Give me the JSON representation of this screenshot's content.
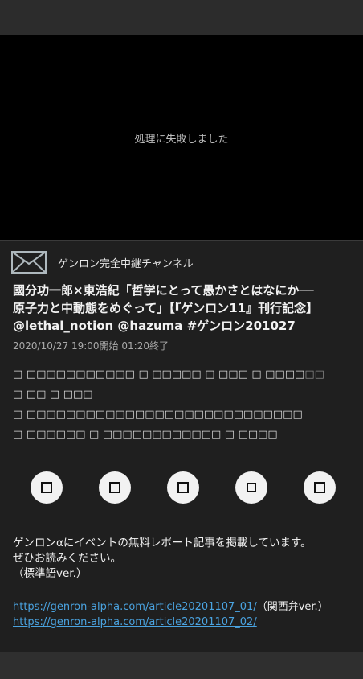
{
  "player": {
    "error_message": "処理に失敗しました"
  },
  "channel": {
    "name": "ゲンロン完全中継チャンネル",
    "icon": "mail-envelope-icon"
  },
  "program": {
    "title_lines": [
      "國分功一郎×東浩紀「哲学にとって愚かさとはなにか──",
      "原子力と中動態をめぐって」【『ゲンロン11』刊行記念】",
      "@lethal_notion @hazuma #ゲンロン201027"
    ],
    "time": "2020/10/27 19:00開始 01:20終了"
  },
  "tags": {
    "line1": "□ □□□□□□□□□□□ □ □□□□□ □ □□□ □ □□□□",
    "line1_fade": "□□",
    "line2": "□ □□ □ □□□",
    "line3": "□ □□□□□□□□□□□□□□□□□□□□□□□□□□□□",
    "line4": "□ □□□□□□ □ □□□□□□□□□□□□ □ □□□□"
  },
  "share_buttons": [
    {
      "icon": "share-twitter-icon"
    },
    {
      "icon": "share-facebook-icon"
    },
    {
      "icon": "share-line-icon"
    },
    {
      "icon": "share-hatena-icon"
    },
    {
      "icon": "share-link-icon"
    }
  ],
  "description": {
    "line1": "ゲンロンαにイベントの無料レポート記事を掲載しています。",
    "line2": "ぜひお読みください。",
    "line3": "（標準語ver.）",
    "link1": "https://genron-alpha.com/article20201107_01/",
    "link1_suffix": "（関西弁ver.）",
    "link2": "https://genron-alpha.com/article20201107_02/"
  },
  "colors": {
    "link": "#4aa3e0",
    "background": "#1f1f1f"
  }
}
